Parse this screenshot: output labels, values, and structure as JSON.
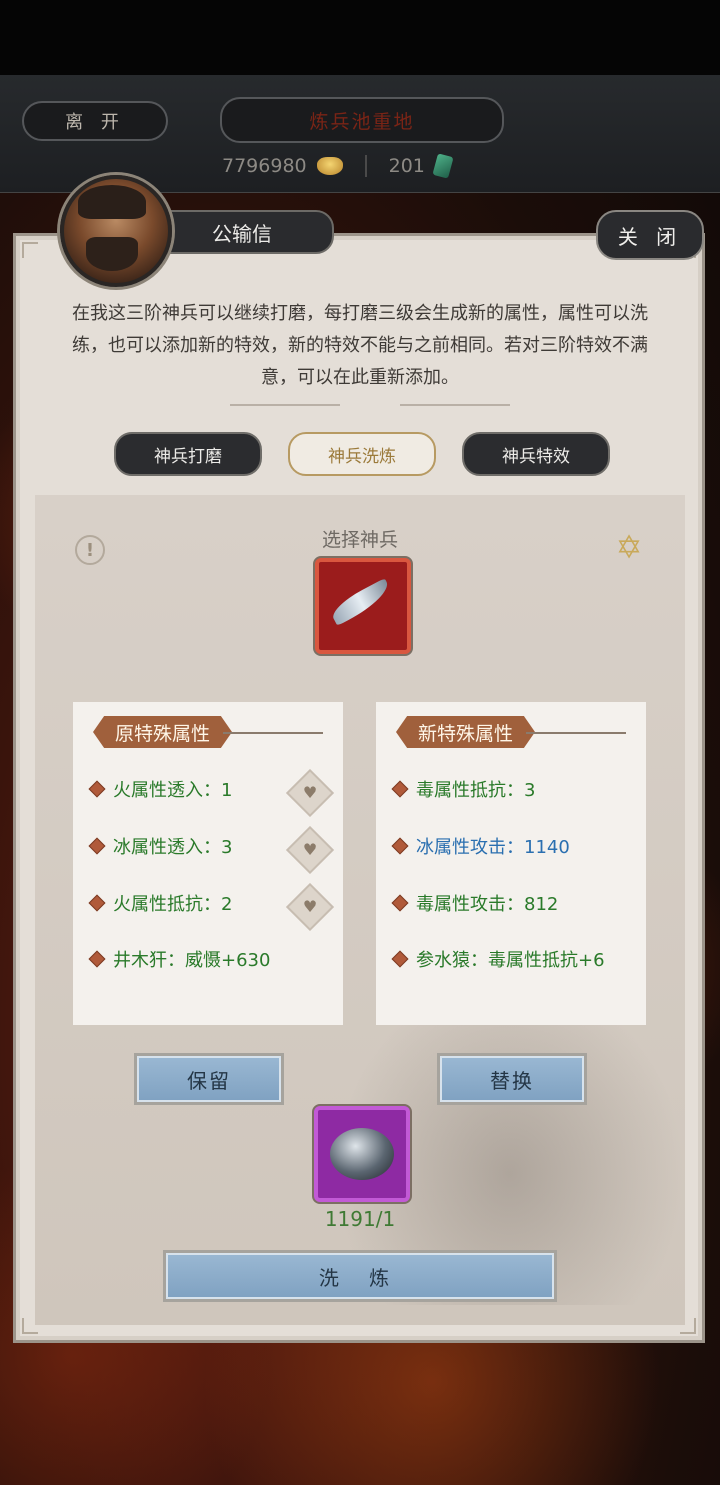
{
  "header": {
    "leave_label": "离 开",
    "location_label": "炼兵池重地",
    "gold_amount": "7796980",
    "jade_amount": "201"
  },
  "npc": {
    "name": "公输信",
    "close_label": "关 闭",
    "description": "在我这三阶神兵可以继续打磨，每打磨三级会生成新的属性，属性可以洗练，也可以添加新的特效，新的特效不能与之前相同。若对三阶特效不满意，可以在此重新添加。"
  },
  "tabs": [
    {
      "label": "神兵打磨",
      "active": false
    },
    {
      "label": "神兵洗炼",
      "active": true
    },
    {
      "label": "神兵特效",
      "active": false
    }
  ],
  "refine": {
    "select_label": "选择神兵",
    "original": {
      "title": "原特殊属性",
      "items": [
        {
          "text": "火属性透入：1"
        },
        {
          "text": "冰属性透入：3"
        },
        {
          "text": "火属性抵抗：2"
        },
        {
          "text": "井木犴：威慑+630"
        }
      ]
    },
    "new": {
      "title": "新特殊属性",
      "items": [
        {
          "text": "毒属性抵抗：3"
        },
        {
          "text": "冰属性攻击：1140"
        },
        {
          "text": "毒属性攻击：812"
        },
        {
          "text": "参水猿：毒属性抵抗+6"
        }
      ]
    },
    "keep_label": "保留",
    "replace_label": "替换",
    "material_count": "1191/1",
    "wash_label": "洗 炼"
  }
}
